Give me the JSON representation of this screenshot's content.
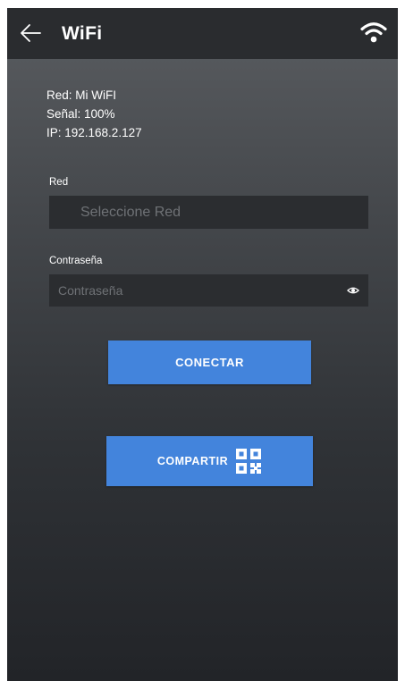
{
  "header": {
    "back_icon": "arrow-left-icon",
    "title": "WiFi",
    "status_icon": "wifi-icon"
  },
  "status": {
    "network": "Red: Mi WiFI",
    "signal": "Señal: 100%",
    "ip": "IP: 192.168.2.127"
  },
  "network_field": {
    "label": "Red",
    "placeholder": "Seleccione Red"
  },
  "password_field": {
    "label": "Contraseña",
    "placeholder": "Contraseña",
    "value": "",
    "toggle_icon": "eye-icon"
  },
  "buttons": {
    "connect_label": "CONECTAR",
    "share_label": "COMPARTIR",
    "share_icon": "qr-code-icon"
  },
  "colors": {
    "accent": "#4384dc",
    "appbar": "#2a2c2f",
    "input_bg": "#2b2d30"
  }
}
